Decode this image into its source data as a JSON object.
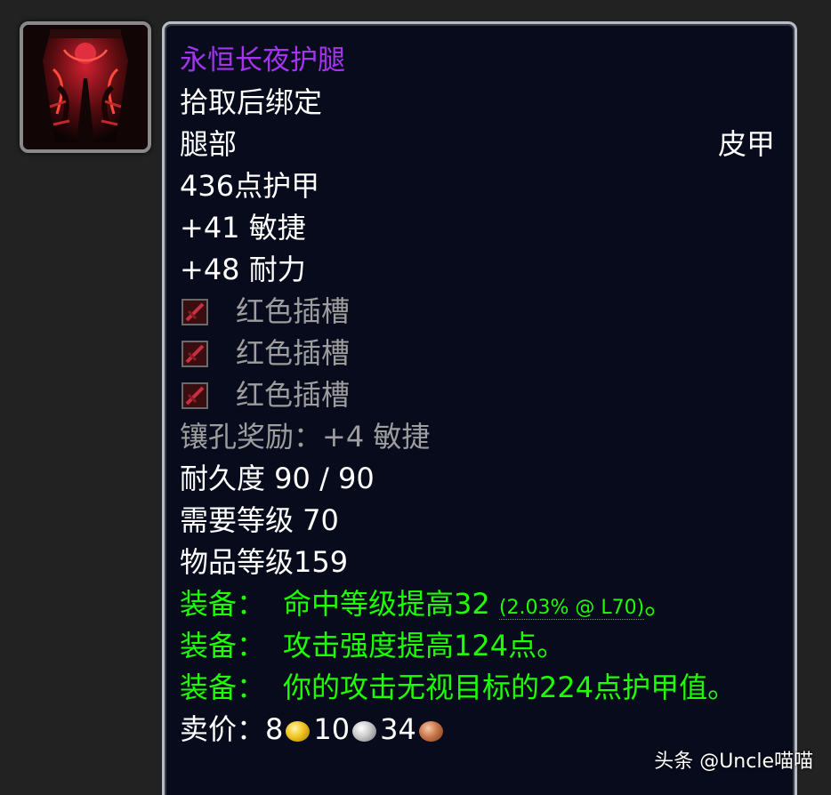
{
  "icon": {
    "name": "leather-legs-item-icon",
    "accent": "#c0202a"
  },
  "tooltip": {
    "item_name": "永恒长夜护腿",
    "quality_color": "#a335ee",
    "bind": "拾取后绑定",
    "slot": "腿部",
    "armor_type": "皮甲",
    "armor": "436点护甲",
    "stats": [
      "+41 敏捷",
      "+48 耐力"
    ],
    "sockets": [
      {
        "label": "红色插槽",
        "icon": "red-socket-icon"
      },
      {
        "label": "红色插槽",
        "icon": "red-socket-icon"
      },
      {
        "label": "红色插槽",
        "icon": "red-socket-icon"
      }
    ],
    "socket_bonus": "镶孔奖励：+4 敏捷",
    "durability": "耐久度 90 / 90",
    "required_level": "需要等级 70",
    "item_level": "物品等级159",
    "equip_effects": [
      {
        "label": "装备：",
        "text": "命中等级提高32",
        "note": "(2.03% @ L70)",
        "suffix": "。"
      },
      {
        "label": "装备：",
        "text": "攻击强度提高124点。"
      },
      {
        "label": "装备：",
        "text": "你的攻击无视目标的224点护甲值。"
      }
    ],
    "sell_price": {
      "label": "卖价：",
      "gold": "8",
      "silver": "10",
      "copper": "34"
    }
  },
  "colors": {
    "common_white": "#ffffff",
    "disabled_gray": "#9d9d9d",
    "equip_green": "#1eff00",
    "tooltip_bg": "#070b1c"
  },
  "watermark": "头条 @Uncle喵喵"
}
